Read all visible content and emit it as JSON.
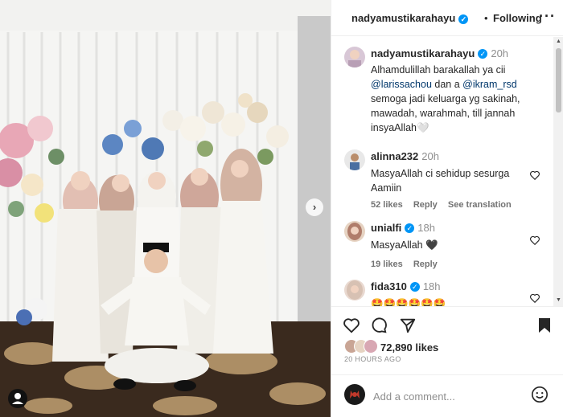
{
  "post_header": {
    "username": "nadyamustikarahayu",
    "separator": "•",
    "follow_state": "Following",
    "more": "···"
  },
  "caption": {
    "username": "nadyamustikarahayu",
    "time": "20h",
    "line1": "Alhamdulillah barakallah ya cii",
    "mention1": "@larissachou",
    "mid": " dan a ",
    "mention2": "@ikram_rsd",
    "line3": "semoga jadi keluarga yg sakinah,",
    "line4": "mawadah, warahmah, till jannah",
    "line5": "insyaAllah🤍"
  },
  "comments": [
    {
      "username": "alinna232",
      "time": "20h",
      "line1": "MasyaAllah ci sehidup sesurga",
      "line2": "Aamiin",
      "likes": "52 likes",
      "reply": "Reply",
      "translate": "See translation"
    },
    {
      "username": "unialfi",
      "time": "18h",
      "text": "MasyaAllah 🖤",
      "likes": "19 likes",
      "reply": "Reply"
    },
    {
      "username": "fida310",
      "time": "18h",
      "text": "🤩🤩🤩🤩🤩🤩"
    }
  ],
  "actions": {
    "likes": "72,890 likes",
    "time_ago": "20 HOURS AGO"
  },
  "add_comment": {
    "placeholder": "Add a comment..."
  },
  "photo": {
    "next": "›"
  },
  "colors": {
    "verified": "#0095f6",
    "link": "#00376b"
  }
}
